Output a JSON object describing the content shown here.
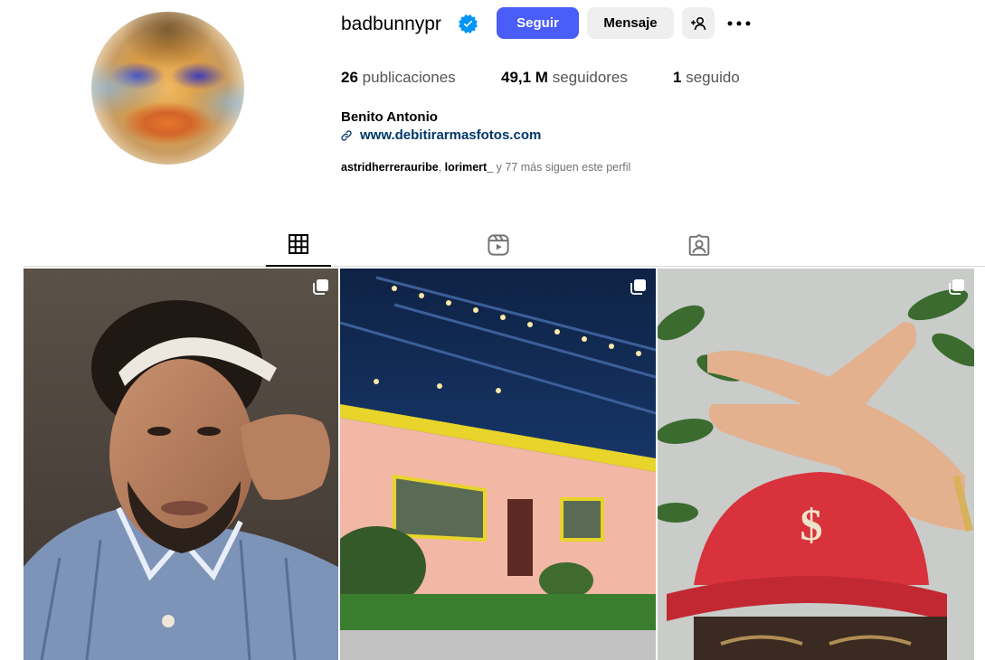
{
  "profile": {
    "username": "badbunnypr",
    "verified": true,
    "full_name": "Benito Antonio",
    "website": "www.debitirarmasfotos.com",
    "avatar_icon": "profile-photo"
  },
  "actions": {
    "follow_label": "Seguir",
    "message_label": "Mensaje",
    "suggest_icon": "add-person-icon",
    "more_icon": "more-options-icon"
  },
  "stats": {
    "posts_count": "26",
    "posts_label": "publicaciones",
    "followers_count": "49,1 M",
    "followers_label": "seguidores",
    "following_count": "1",
    "following_label": "seguido"
  },
  "followed_by": {
    "name1": "astridherrerauribe",
    "separator": ",",
    "name2": "lorimert_",
    "suffix": "y 77 más siguen este perfil"
  },
  "tabs": [
    {
      "name": "posts",
      "icon": "grid-icon",
      "active": true
    },
    {
      "name": "reels",
      "icon": "reels-icon",
      "active": false
    },
    {
      "name": "tagged",
      "icon": "tagged-icon",
      "active": false
    }
  ],
  "posts": [
    {
      "description": "selfie-headband",
      "multi": true
    },
    {
      "description": "pink-house-stage",
      "multi": true
    },
    {
      "description": "red-cap-peace-sign",
      "multi": true
    }
  ],
  "colors": {
    "follow_button": "#4a5df9",
    "secondary_button": "#efefef",
    "link": "#00376b",
    "verified_badge": "#0095f6",
    "muted_text": "#737373"
  }
}
